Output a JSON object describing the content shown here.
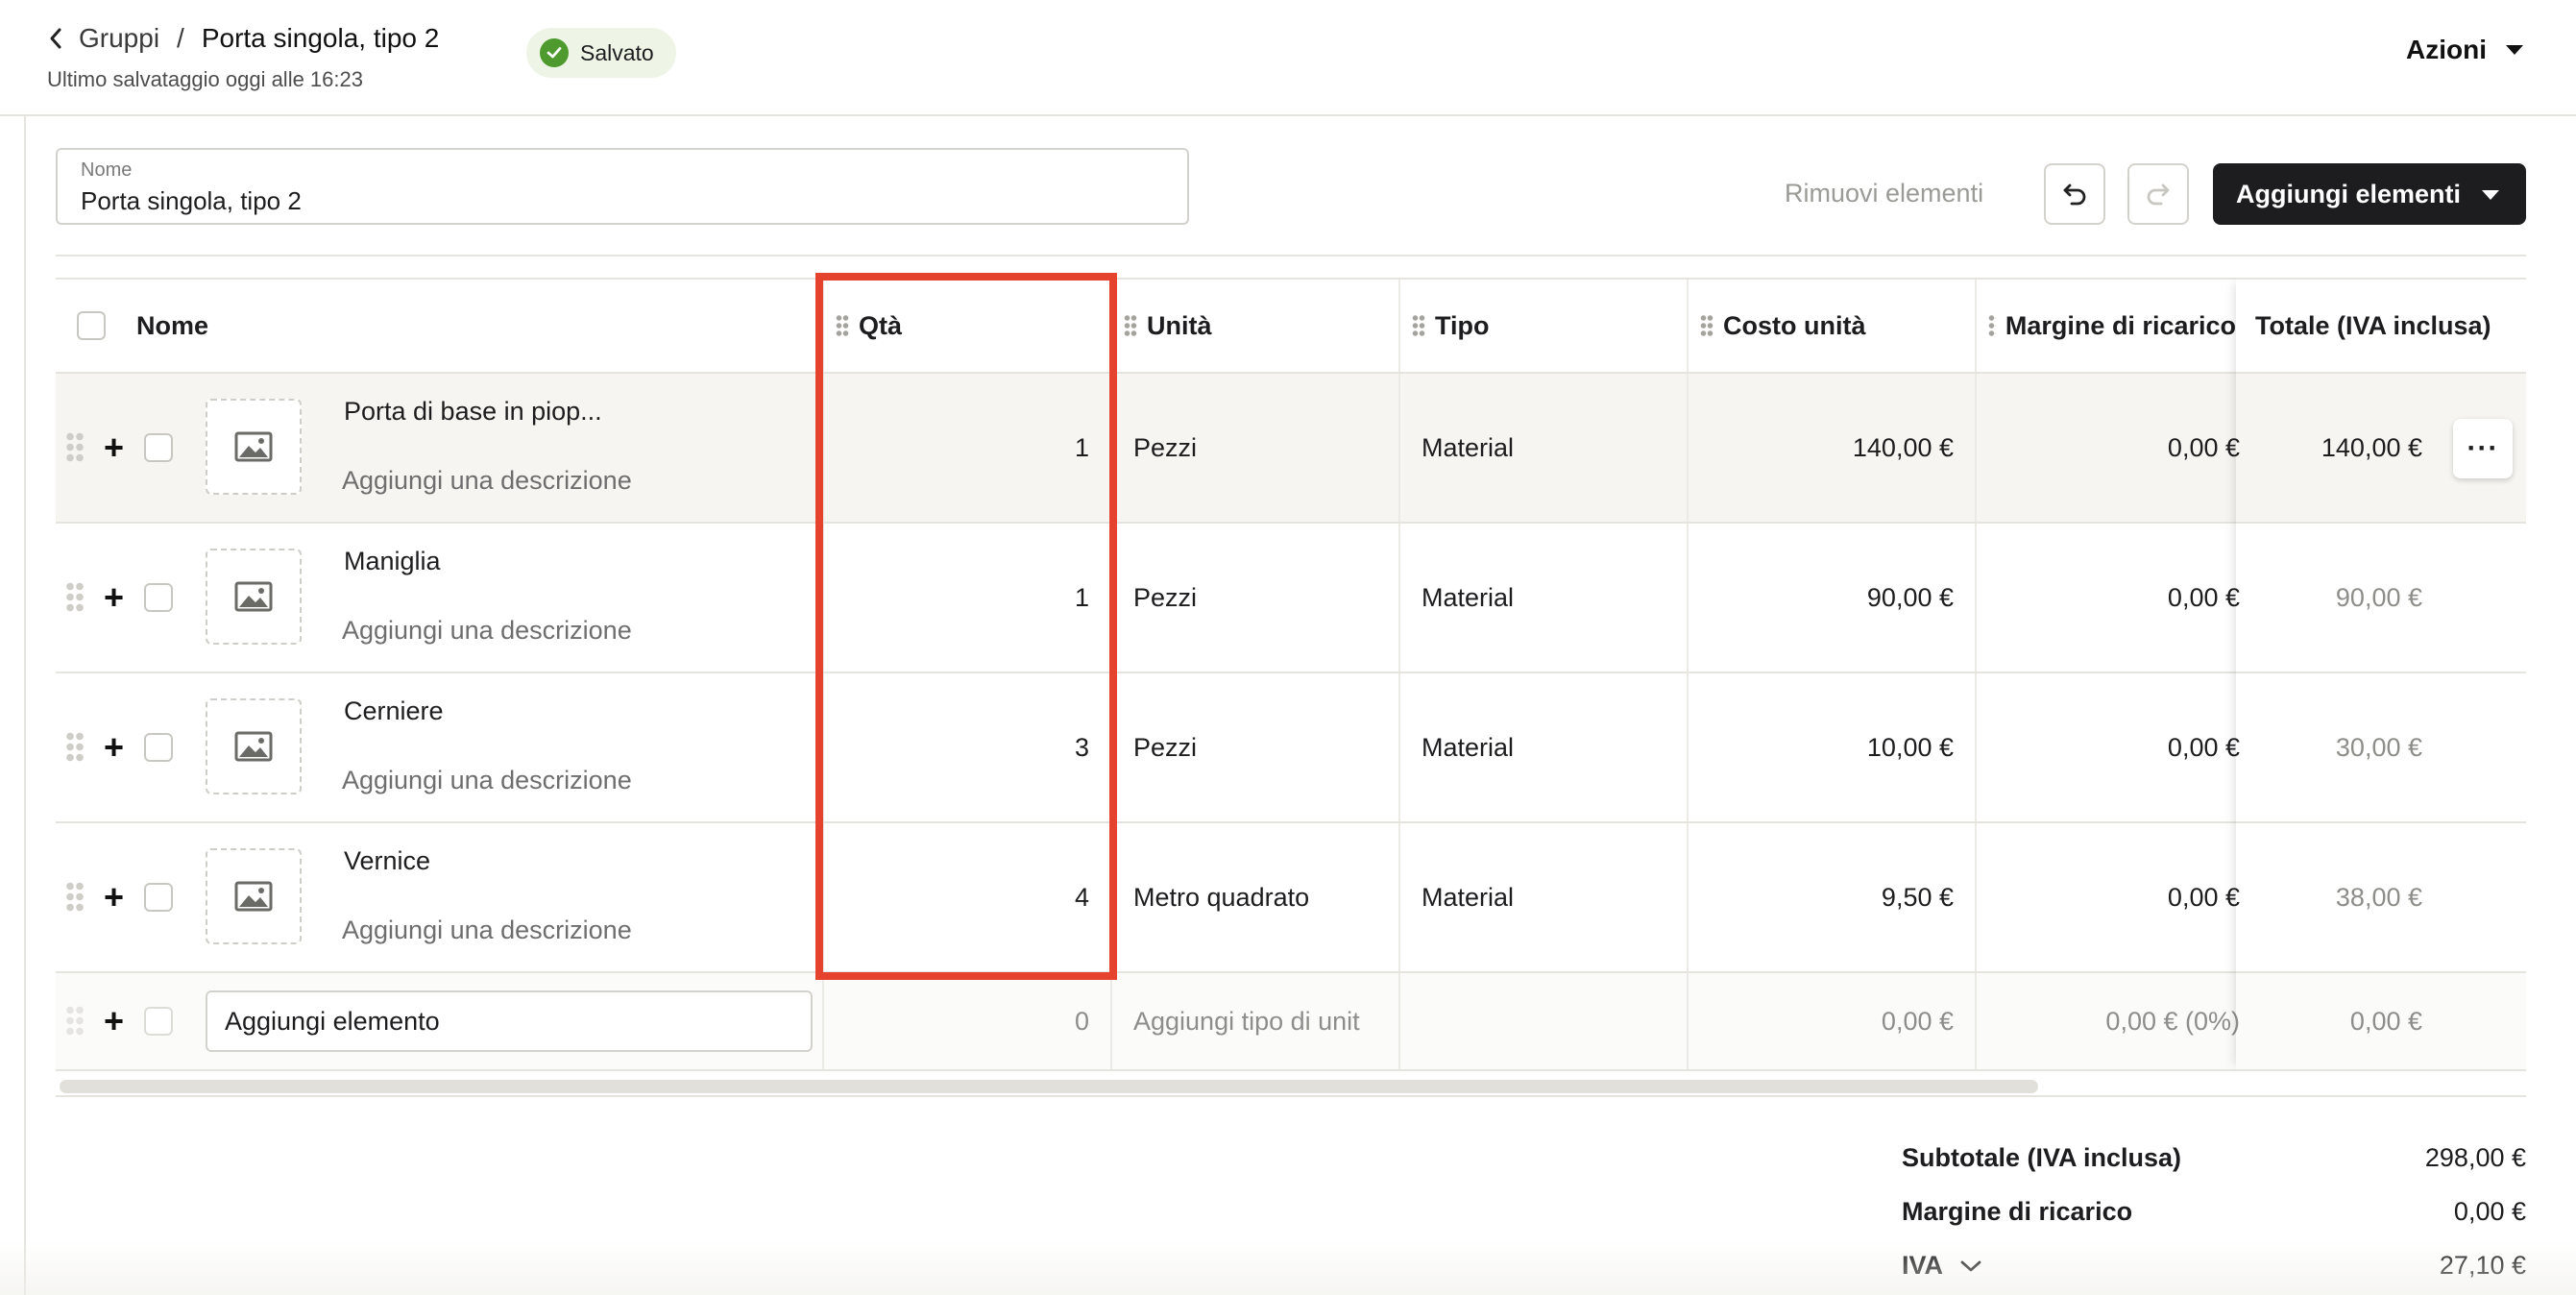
{
  "header": {
    "back_label": "Gruppi",
    "separator": "/",
    "current": "Porta singola, tipo 2",
    "last_saved": "Ultimo salvataggio oggi alle 16:23",
    "status": "Salvato",
    "actions": "Azioni"
  },
  "toolbar": {
    "name_label": "Nome",
    "name_value": "Porta singola, tipo 2",
    "remove_items": "Rimuovi elementi",
    "add_items": "Aggiungi elementi"
  },
  "table": {
    "columns": {
      "name": "Nome",
      "qty": "Qtà",
      "unit": "Unità",
      "type": "Tipo",
      "unit_cost": "Costo unità",
      "markup": "Margine di ricarico",
      "total": "Totale (IVA inclusa)"
    },
    "rows": [
      {
        "name": "Porta di base in piop...",
        "desc": "Aggiungi una descrizione",
        "qty": "1",
        "unit": "Pezzi",
        "type": "Material",
        "unit_cost": "140,00 €",
        "markup": "0,00 €",
        "total": "140,00 €"
      },
      {
        "name": "Maniglia",
        "desc": "Aggiungi una descrizione",
        "qty": "1",
        "unit": "Pezzi",
        "type": "Material",
        "unit_cost": "90,00 €",
        "markup": "0,00 €",
        "total": "90,00 €"
      },
      {
        "name": "Cerniere",
        "desc": "Aggiungi una descrizione",
        "qty": "3",
        "unit": "Pezzi",
        "type": "Material",
        "unit_cost": "10,00 €",
        "markup": "0,00 €",
        "total": "30,00 €"
      },
      {
        "name": "Vernice",
        "desc": "Aggiungi una descrizione",
        "qty": "4",
        "unit": "Metro quadrato",
        "type": "Material",
        "unit_cost": "9,50 €",
        "markup": "0,00 €",
        "total": "38,00 €"
      }
    ],
    "new_row": {
      "placeholder": "Aggiungi elemento",
      "qty": "0",
      "unit_placeholder": "Aggiungi tipo di unit",
      "unit_cost": "0,00 €",
      "markup": "0,00 € (0%)",
      "total": "0,00 €"
    },
    "more_label": "···"
  },
  "summary": {
    "subtotal_label": "Subtotale (IVA inclusa)",
    "subtotal_value": "298,00 €",
    "markup_label": "Margine di ricarico",
    "markup_value": "0,00 €",
    "vat_label": "IVA",
    "vat_value": "27,10 €"
  },
  "colors": {
    "highlight": "#e5432d",
    "primary_button": "#1d1d1f",
    "saved_badge_bg": "#eef5e6",
    "saved_check": "#4e9a2e"
  }
}
